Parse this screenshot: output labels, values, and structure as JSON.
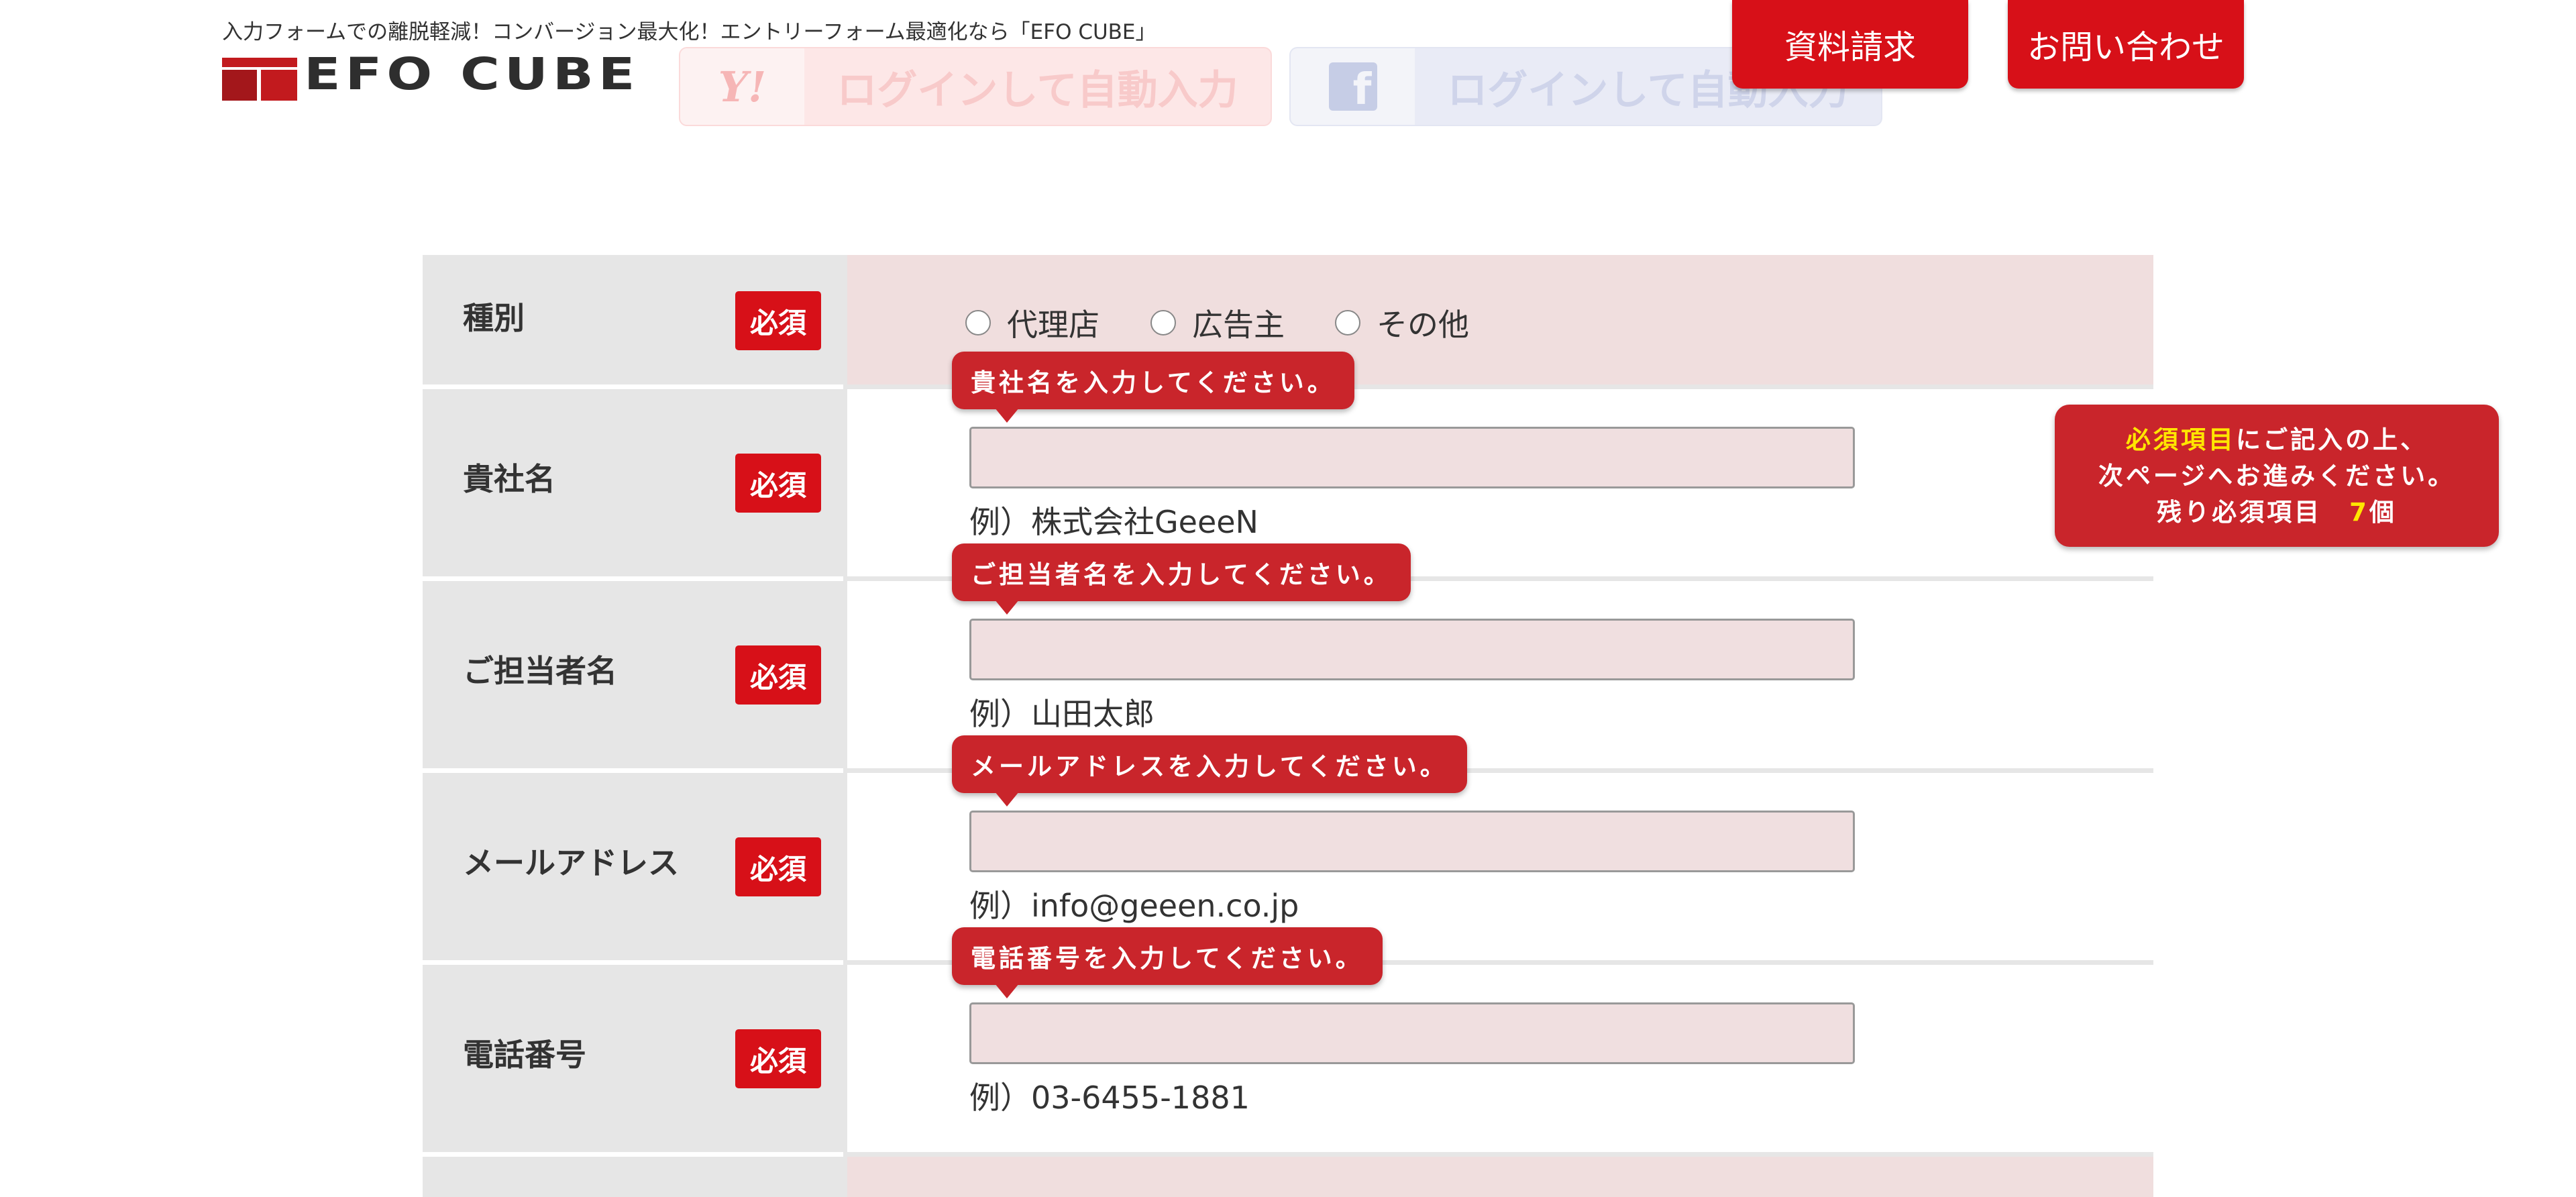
{
  "header": {
    "tagline": "入力フォームでの離脱軽減！コンバージョン最大化！エントリーフォーム最適化なら「EFO CUBE」",
    "logo_text": "EFO CUBE",
    "yahoo_login_label": "ログインして自動入力",
    "facebook_login_label": "ログインして自動入力",
    "doc_request_label": "資料請求",
    "contact_label": "お問い合わせ"
  },
  "colors": {
    "brand_red": "#d71018",
    "tooltip_red": "#c9252b",
    "label_bg": "#e6e6e6",
    "pink_bg": "#f0dede",
    "highlight_yellow": "#ffe600"
  },
  "form": {
    "required_label": "必須",
    "rows": [
      {
        "label": "種別",
        "options": [
          "代理店",
          "広告主",
          "その他"
        ]
      },
      {
        "label": "貴社名",
        "tooltip": "貴社名を入力してください。",
        "value": "",
        "example": "例）株式会社GeeeN"
      },
      {
        "label": "ご担当者名",
        "tooltip": "ご担当者名を入力してください。",
        "value": "",
        "example": "例）山田太郎"
      },
      {
        "label": "メールアドレス",
        "tooltip": "メールアドレスを入力してください。",
        "value": "",
        "example": "例）info@geeen.co.jp"
      },
      {
        "label": "電話番号",
        "tooltip": "電話番号を入力してください。",
        "value": "",
        "example": "例）03-6455-1881"
      }
    ]
  },
  "notice": {
    "highlight": "必須項目",
    "line1_rest": "にご記入の上、",
    "line2": "次ページへお進みください。",
    "line3_prefix": "残り必須項目　",
    "remaining_count": "7",
    "line3_suffix": "個"
  }
}
